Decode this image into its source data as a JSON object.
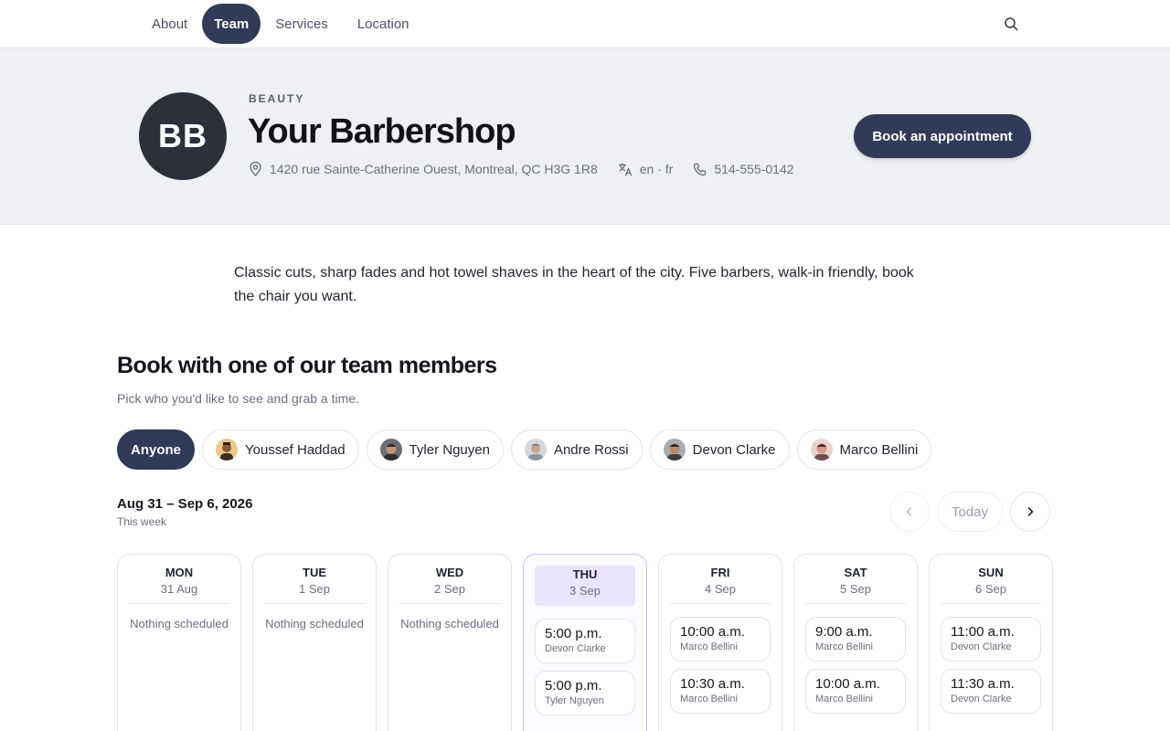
{
  "nav": {
    "items": [
      {
        "label": "About",
        "active": false
      },
      {
        "label": "Team",
        "active": true
      },
      {
        "label": "Services",
        "active": false
      },
      {
        "label": "Location",
        "active": false
      }
    ]
  },
  "business": {
    "initials": "BB",
    "category": "BEAUTY",
    "name": "Your Barbershop",
    "address": "1420 rue Sainte-Catherine Ouest, Montreal, QC H3G 1R8",
    "languages": "en · fr",
    "phone": "514-555-0142",
    "book_label": "Book an appointment"
  },
  "intro": "Classic cuts, sharp fades and hot towel shaves in the heart of the city. Five barbers, walk-in friendly, book the chair you want.",
  "team_section": {
    "title": "Book with one of our team members",
    "subtitle": "Pick who you'd like to see and grab a time.",
    "members": [
      {
        "label": "Anyone",
        "active": true
      },
      {
        "label": "Youssef Haddad",
        "active": false
      },
      {
        "label": "Tyler Nguyen",
        "active": false
      },
      {
        "label": "Andre Rossi",
        "active": false
      },
      {
        "label": "Devon Clarke",
        "active": false
      },
      {
        "label": "Marco Bellini",
        "active": false
      }
    ]
  },
  "calendar": {
    "range": "Aug 31 – Sep 6, 2026",
    "range_sub": "This week",
    "today_label": "Today",
    "empty_label": "Nothing scheduled",
    "days": [
      {
        "name": "MON",
        "date": "31 Aug",
        "slots": []
      },
      {
        "name": "TUE",
        "date": "1 Sep",
        "slots": []
      },
      {
        "name": "WED",
        "date": "2 Sep",
        "slots": []
      },
      {
        "name": "THU",
        "date": "3 Sep",
        "slots": [
          {
            "time": "5:00 p.m.",
            "who": "Devon Clarke"
          },
          {
            "time": "5:00 p.m.",
            "who": "Tyler Nguyen"
          }
        ]
      },
      {
        "name": "FRI",
        "date": "4 Sep",
        "slots": [
          {
            "time": "10:00 a.m.",
            "who": "Marco Bellini"
          },
          {
            "time": "10:30 a.m.",
            "who": "Marco Bellini"
          }
        ]
      },
      {
        "name": "SAT",
        "date": "5 Sep",
        "slots": [
          {
            "time": "9:00 a.m.",
            "who": "Marco Bellini"
          },
          {
            "time": "10:00 a.m.",
            "who": "Marco Bellini"
          }
        ]
      },
      {
        "name": "SUN",
        "date": "6 Sep",
        "slots": [
          {
            "time": "11:00 a.m.",
            "who": "Devon Clarke"
          },
          {
            "time": "11:30 a.m.",
            "who": "Devon Clarke"
          }
        ]
      }
    ]
  },
  "colors": {
    "primary": "#2f3b57",
    "hero_bg": "#eff0f4",
    "today_highlight": "#ebe5fb"
  }
}
